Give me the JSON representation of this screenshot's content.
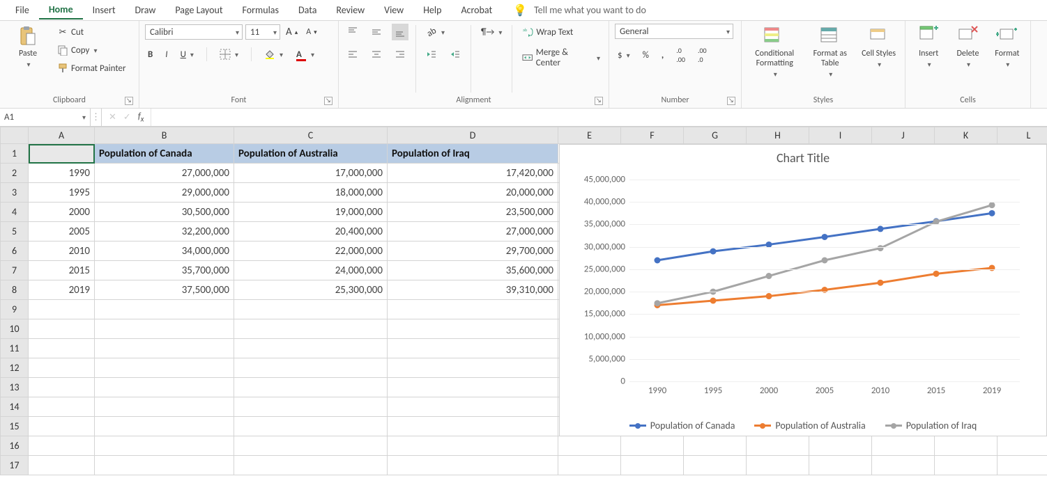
{
  "tabs": {
    "items": [
      "File",
      "Home",
      "Insert",
      "Draw",
      "Page Layout",
      "Formulas",
      "Data",
      "Review",
      "View",
      "Help",
      "Acrobat"
    ],
    "active": "Home",
    "tell_me": "Tell me what you want to do"
  },
  "ribbon": {
    "clipboard": {
      "label": "Clipboard",
      "paste": "Paste",
      "cut": "Cut",
      "copy": "Copy",
      "painter": "Format Painter"
    },
    "font": {
      "label": "Font",
      "name": "Calibri",
      "size": "11"
    },
    "alignment": {
      "label": "Alignment",
      "wrap": "Wrap Text",
      "merge": "Merge & Center"
    },
    "number": {
      "label": "Number",
      "format": "General"
    },
    "styles": {
      "label": "Styles",
      "cf": "Conditional Formatting",
      "fat": "Format as Table",
      "cs": "Cell Styles"
    },
    "cells": {
      "label": "Cells",
      "insert": "Insert",
      "delete": "Delete",
      "format": "Format"
    }
  },
  "formula_bar": {
    "name_box": "A1",
    "formula": ""
  },
  "grid": {
    "columns": [
      "A",
      "B",
      "C",
      "D",
      "E",
      "F",
      "G",
      "H",
      "I",
      "J",
      "K",
      "L"
    ],
    "headers": {
      "A": "",
      "B": "Population of Canada",
      "C": "Population of Australia",
      "D": "Population of Iraq"
    },
    "rows": [
      {
        "A": "1990",
        "B": "27,000,000",
        "C": "17,000,000",
        "D": "17,420,000"
      },
      {
        "A": "1995",
        "B": "29,000,000",
        "C": "18,000,000",
        "D": "20,000,000"
      },
      {
        "A": "2000",
        "B": "30,500,000",
        "C": "19,000,000",
        "D": "23,500,000"
      },
      {
        "A": "2005",
        "B": "32,200,000",
        "C": "20,400,000",
        "D": "27,000,000"
      },
      {
        "A": "2010",
        "B": "34,000,000",
        "C": "22,000,000",
        "D": "29,700,000"
      },
      {
        "A": "2015",
        "B": "35,700,000",
        "C": "24,000,000",
        "D": "35,600,000"
      },
      {
        "A": "2019",
        "B": "37,500,000",
        "C": "25,300,000",
        "D": "39,310,000"
      }
    ],
    "total_rows": 17
  },
  "chart_data": {
    "type": "line",
    "title": "Chart Title",
    "categories": [
      "1990",
      "1995",
      "2000",
      "2005",
      "2010",
      "2015",
      "2019"
    ],
    "series": [
      {
        "name": "Population of Canada",
        "color": "#4472c4",
        "values": [
          27000000,
          29000000,
          30500000,
          32200000,
          34000000,
          35700000,
          37500000
        ]
      },
      {
        "name": "Population of Australia",
        "color": "#ed7d31",
        "values": [
          17000000,
          18000000,
          19000000,
          20400000,
          22000000,
          24000000,
          25300000
        ]
      },
      {
        "name": "Population of Iraq",
        "color": "#a5a5a5",
        "values": [
          17420000,
          20000000,
          23500000,
          27000000,
          29700000,
          35600000,
          39310000
        ]
      }
    ],
    "ylim": [
      0,
      45000000
    ],
    "yticks": [
      0,
      5000000,
      10000000,
      15000000,
      20000000,
      25000000,
      30000000,
      35000000,
      40000000,
      45000000
    ]
  }
}
